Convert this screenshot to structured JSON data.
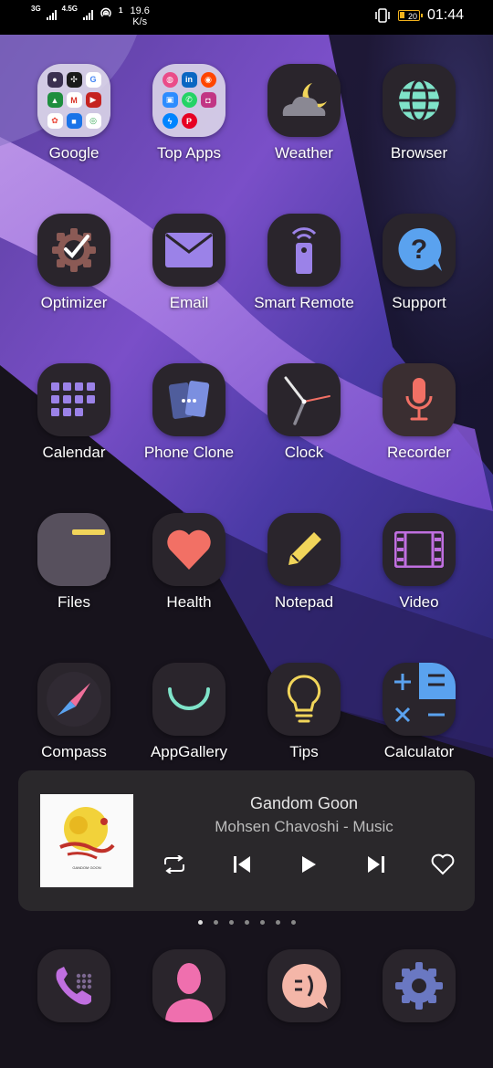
{
  "status_bar": {
    "network_3g": "3G",
    "network_4_5g": "4.5G",
    "hotspot_count": "1",
    "speed_value": "19.6",
    "speed_unit": "K/s",
    "battery_level": "20",
    "time": "01:44"
  },
  "apps": [
    {
      "label": "Google",
      "icon": "folder-google"
    },
    {
      "label": "Top Apps",
      "icon": "folder-top-apps"
    },
    {
      "label": "Weather",
      "icon": "weather-moon-cloud-icon"
    },
    {
      "label": "Browser",
      "icon": "globe-icon"
    },
    {
      "label": "Optimizer",
      "icon": "gear-check-icon"
    },
    {
      "label": "Email",
      "icon": "envelope-icon"
    },
    {
      "label": "Smart Remote",
      "icon": "remote-icon"
    },
    {
      "label": "Support",
      "icon": "question-bubble-icon"
    },
    {
      "label": "Calendar",
      "icon": "calendar-grid-icon"
    },
    {
      "label": "Phone Clone",
      "icon": "phone-clone-icon"
    },
    {
      "label": "Clock",
      "icon": "clock-icon"
    },
    {
      "label": "Recorder",
      "icon": "microphone-icon"
    },
    {
      "label": "Files",
      "icon": "folder-icon"
    },
    {
      "label": "Health",
      "icon": "heart-icon"
    },
    {
      "label": "Notepad",
      "icon": "pencil-icon"
    },
    {
      "label": "Video",
      "icon": "film-icon"
    },
    {
      "label": "Compass",
      "icon": "compass-icon"
    },
    {
      "label": "AppGallery",
      "icon": "shopping-bag-icon"
    },
    {
      "label": "Tips",
      "icon": "lightbulb-icon"
    },
    {
      "label": "Calculator",
      "icon": "calculator-icon"
    }
  ],
  "music_widget": {
    "title": "Gandom Goon",
    "subtitle": "Mohsen Chavoshi  - Music",
    "album_caption": "GANDOM GOON"
  },
  "page_indicator": {
    "count": 7,
    "active_index": 0
  },
  "dock": [
    {
      "name": "phone",
      "icon": "phone-icon"
    },
    {
      "name": "contacts",
      "icon": "contact-icon"
    },
    {
      "name": "messages",
      "icon": "message-bubble-icon"
    },
    {
      "name": "settings",
      "icon": "settings-gear-icon"
    }
  ],
  "colors": {
    "icon_bg": "#2a252c",
    "accent_purple": "#9b82e8",
    "accent_pink": "#ef6fae",
    "accent_coral": "#f27065",
    "accent_yellow": "#f1d55a",
    "accent_teal": "#7fe3c9",
    "accent_blue": "#5aa2ef",
    "widget_bg": "#2a282b"
  }
}
